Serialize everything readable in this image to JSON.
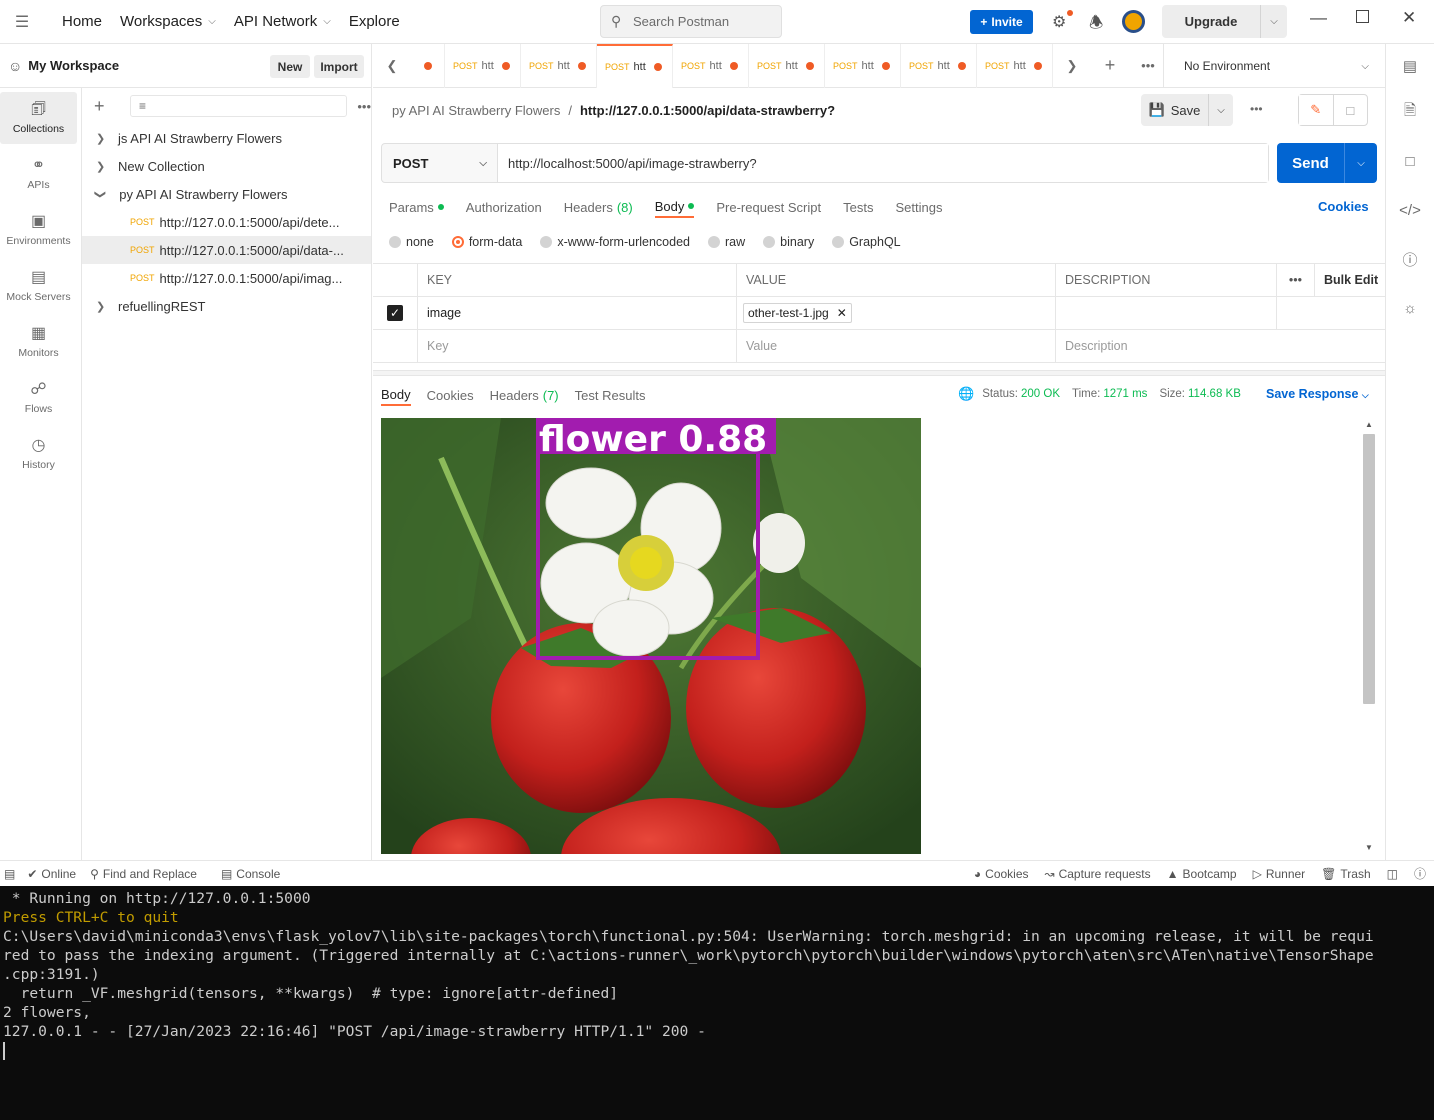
{
  "topbar": {
    "nav": [
      "Home",
      "Workspaces",
      "API Network",
      "Explore"
    ],
    "search_placeholder": "Search Postman",
    "invite_label": "Invite",
    "upgrade_label": "Upgrade"
  },
  "workspace": {
    "name": "My Workspace",
    "new_label": "New",
    "import_label": "Import"
  },
  "iconbar": [
    {
      "label": "Collections",
      "icon": "collections-icon"
    },
    {
      "label": "APIs",
      "icon": "apis-icon"
    },
    {
      "label": "Environments",
      "icon": "environments-icon"
    },
    {
      "label": "Mock Servers",
      "icon": "mock-servers-icon"
    },
    {
      "label": "Monitors",
      "icon": "monitors-icon"
    },
    {
      "label": "Flows",
      "icon": "flows-icon"
    },
    {
      "label": "History",
      "icon": "history-icon"
    }
  ],
  "tree": {
    "collections": [
      {
        "name": "js API AI Strawberry Flowers",
        "expanded": false
      },
      {
        "name": "New Collection",
        "expanded": false
      },
      {
        "name": "py API AI Strawberry Flowers",
        "expanded": true
      },
      {
        "name": "refuellingREST",
        "expanded": false
      }
    ],
    "requests": [
      {
        "method": "POST",
        "name": "http://127.0.0.1:5000/api/dete..."
      },
      {
        "method": "POST",
        "name": "http://127.0.0.1:5000/api/data-..."
      },
      {
        "method": "POST",
        "name": "http://127.0.0.1:5000/api/imag..."
      }
    ]
  },
  "tabs": {
    "items": [
      {
        "method": "POST",
        "label": "htt"
      },
      {
        "method": "POST",
        "label": "htt"
      },
      {
        "method": "POST",
        "label": "htt"
      },
      {
        "method": "POST",
        "label": "htt"
      },
      {
        "method": "POST",
        "label": "htt"
      },
      {
        "method": "POST",
        "label": "htt"
      },
      {
        "method": "POST",
        "label": "htt"
      },
      {
        "method": "POST",
        "label": "htt"
      }
    ],
    "environment": "No Environment"
  },
  "request": {
    "breadcrumb_collection": "py API AI Strawberry Flowers",
    "breadcrumb_sep": "/",
    "breadcrumb_request": "http://127.0.0.1:5000/api/data-strawberry?",
    "save_label": "Save",
    "method": "POST",
    "url": "http://localhost:5000/api/image-strawberry?",
    "send_label": "Send",
    "tabs": [
      "Params",
      "Authorization",
      "Headers",
      "Body",
      "Pre-request Script",
      "Tests",
      "Settings"
    ],
    "headers_count": "(8)",
    "cookies_label": "Cookies",
    "body_types": [
      "none",
      "form-data",
      "x-www-form-urlencoded",
      "raw",
      "binary",
      "GraphQL"
    ],
    "table": {
      "headers": [
        "KEY",
        "VALUE",
        "DESCRIPTION"
      ],
      "bulk_edit": "Bulk Edit",
      "row": {
        "key": "image",
        "value": "other-test-1.jpg"
      },
      "placeholders": {
        "key": "Key",
        "value": "Value",
        "description": "Description"
      }
    }
  },
  "response": {
    "tabs": [
      "Body",
      "Cookies",
      "Headers",
      "Test Results"
    ],
    "headers_count": "(7)",
    "status_label": "Status:",
    "status": "200 OK",
    "time_label": "Time:",
    "time": "1271 ms",
    "size_label": "Size:",
    "size": "114.68 KB",
    "save_response": "Save Response",
    "detection_label": "flower  0.88"
  },
  "statusbar": {
    "online": "Online",
    "find_replace": "Find and Replace",
    "console": "Console",
    "cookies": "Cookies",
    "capture": "Capture requests",
    "bootcamp": "Bootcamp",
    "runner": "Runner",
    "trash": "Trash"
  },
  "terminal": {
    "lines": [
      " * Running on http://127.0.0.1:5000",
      "Press CTRL+C to quit",
      "C:\\Users\\david\\miniconda3\\envs\\flask_yolov7\\lib\\site-packages\\torch\\functional.py:504: UserWarning: torch.meshgrid: in an upcoming release, it will be requi",
      "red to pass the indexing argument. (Triggered internally at C:\\actions-runner\\_work\\pytorch\\pytorch\\builder\\windows\\pytorch\\aten\\src\\ATen\\native\\TensorShape",
      ".cpp:3191.)",
      "  return _VF.meshgrid(tensors, **kwargs)  # type: ignore[attr-defined]",
      "2 flowers,",
      "127.0.0.1 - - [27/Jan/2023 22:16:46] \"POST /api/image-strawberry HTTP/1.1\" 200 -"
    ]
  }
}
